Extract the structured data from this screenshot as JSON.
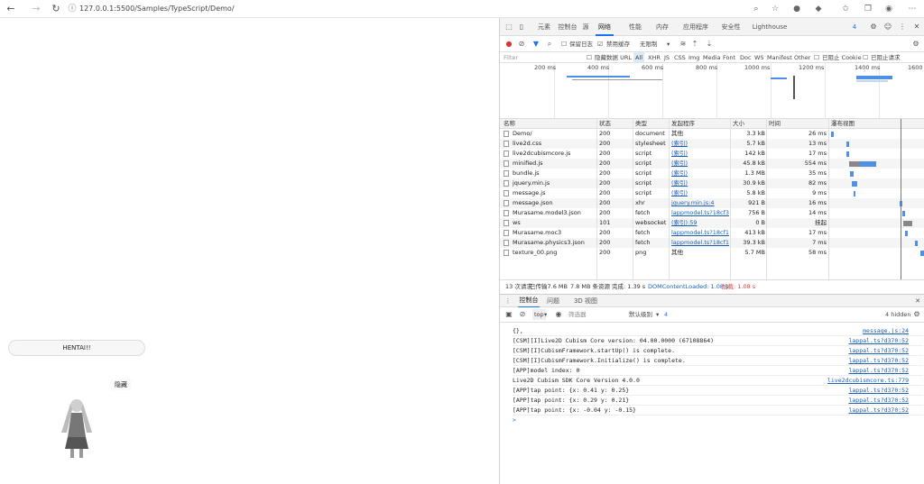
{
  "browser": {
    "url": "127.0.0.1:5500/Samples/TypeScript/Demo/"
  },
  "page": {
    "hentai_button": "HENTAI!!",
    "hide_button": "隐藏"
  },
  "devtools": {
    "tabs": [
      "元素",
      "控制台",
      "源",
      "网络",
      "性能",
      "内存",
      "应用程序",
      "安全性",
      "Lighthouse"
    ],
    "issues_badge": "4",
    "toolbar": {
      "preserve_log": "保留日志",
      "disable_cache": "禁用缓存",
      "throttle": "无限制"
    },
    "filter": {
      "placeholder": "Filter",
      "hide_data_urls": "隐藏数据 URL",
      "types": [
        "All",
        "XHR",
        "JS",
        "CSS",
        "Img",
        "Media",
        "Font",
        "Doc",
        "WS",
        "Manifest",
        "Other"
      ],
      "blocked_cookies": "已阻止 Cookie",
      "blocked_requests": "已阻止请求"
    },
    "overview_ticks": [
      "200 ms",
      "400 ms",
      "600 ms",
      "800 ms",
      "1000 ms",
      "1200 ms",
      "1400 ms",
      "1600"
    ],
    "columns": [
      "名称",
      "状态",
      "类型",
      "发起程序",
      "大小",
      "时间",
      "瀑布视图"
    ],
    "requests": [
      {
        "name": "Demo/",
        "status": "200",
        "type": "document",
        "initiator": "其他",
        "size": "3.3 kB",
        "time": "26 ms"
      },
      {
        "name": "live2d.css",
        "status": "200",
        "type": "stylesheet",
        "initiator": "(索引)",
        "size": "5.7 kB",
        "time": "13 ms"
      },
      {
        "name": "live2dcubismcore.js",
        "status": "200",
        "type": "script",
        "initiator": "(索引)",
        "size": "142 kB",
        "time": "17 ms"
      },
      {
        "name": "minified.js",
        "status": "200",
        "type": "script",
        "initiator": "(索引)",
        "size": "45.8 kB",
        "time": "554 ms"
      },
      {
        "name": "bundle.js",
        "status": "200",
        "type": "script",
        "initiator": "(索引)",
        "size": "1.3 MB",
        "time": "35 ms"
      },
      {
        "name": "jquery.min.js",
        "status": "200",
        "type": "script",
        "initiator": "(索引)",
        "size": "30.9 kB",
        "time": "82 ms"
      },
      {
        "name": "message.js",
        "status": "200",
        "type": "script",
        "initiator": "(索引)",
        "size": "5.8 kB",
        "time": "9 ms"
      },
      {
        "name": "message.json",
        "status": "200",
        "type": "xhr",
        "initiator": "jquery.min.js:4",
        "size": "921 B",
        "time": "16 ms"
      },
      {
        "name": "Murasame.model3.json",
        "status": "200",
        "type": "fetch",
        "initiator": "lappmodel.ts?18cf30",
        "size": "756 B",
        "time": "14 ms"
      },
      {
        "name": "ws",
        "status": "101",
        "type": "websocket",
        "initiator": "(索引):59",
        "size": "0 B",
        "time": "挂起"
      },
      {
        "name": "Murasame.moc3",
        "status": "200",
        "type": "fetch",
        "initiator": "lappmodel.ts?18cf1...",
        "size": "413 kB",
        "time": "17 ms"
      },
      {
        "name": "Murasame.physics3.json",
        "status": "200",
        "type": "fetch",
        "initiator": "lappmodel.ts?18cf1...",
        "size": "39.3 kB",
        "time": "7 ms"
      },
      {
        "name": "texture_00.png",
        "status": "200",
        "type": "png",
        "initiator": "其他",
        "size": "5.7 MB",
        "time": "58 ms"
      }
    ],
    "status_bar": {
      "requests": "13 次请求",
      "transferred": "已传输7.6 MB",
      "resources": "7.8 MB 条资源",
      "finish": "完成: 1.39 s",
      "dcl": "DOMContentLoaded: 1.08 s",
      "load": "加载: 1.08 s"
    },
    "drawer": {
      "tabs": [
        "控制台",
        "问题",
        "3D 视图"
      ]
    },
    "console_toolbar": {
      "context": "top",
      "filter_placeholder": "筛选器",
      "levels": "默认级别",
      "issues": "4",
      "hidden": "4 hidden"
    },
    "console": [
      {
        "text": "{},",
        "src": "message.js:24"
      },
      {
        "text": "[CSM][I]Live2D Cubism Core version: 04.00.0000 (67108864)",
        "src": "lappal.ts?d370:52"
      },
      {
        "text": "[CSM][I]CubismFramework.startUp() is complete.",
        "src": "lappal.ts?d370:52"
      },
      {
        "text": "[CSM][I]CubismFramework.Initialize() is complete.",
        "src": "lappal.ts?d370:52"
      },
      {
        "text": "[APP]model index: 0",
        "src": "lappal.ts?d370:52"
      },
      {
        "text": "Live2D Cubism SDK Core Version 4.0.0",
        "src": "live2dcubismcore.ts:779"
      },
      {
        "text": "[APP]tap point: {x: 0.41 y: 0.25}",
        "src": "lappal.ts?d370:52"
      },
      {
        "text": "[APP]tap point: {x: 0.29 y: 0.21}",
        "src": "lappal.ts?d370:52"
      },
      {
        "text": "[APP]tap point: {x: -0.04 y: -0.15}",
        "src": "lappal.ts?d370:52"
      }
    ],
    "prompt": ">"
  }
}
